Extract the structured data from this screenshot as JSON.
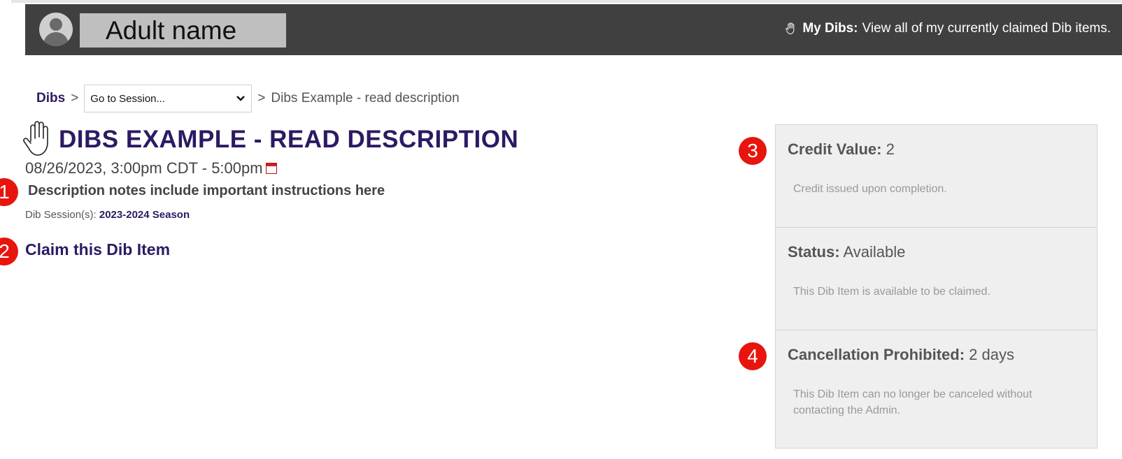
{
  "header": {
    "user_name": "Adult name",
    "my_dibs_label": "My Dibs:",
    "my_dibs_text": "View all of my currently claimed Dib items."
  },
  "breadcrumb": {
    "dibs": "Dibs",
    "separator": ">",
    "session_select": "Go to Session...",
    "current_prefix": ">",
    "current": "Dibs Example - read description"
  },
  "item": {
    "title": "DIBS EXAMPLE - READ DESCRIPTION",
    "datetime": "08/26/2023, 3:00pm CDT - 5:00pm",
    "description": "Description notes include important instructions here",
    "sessions_label": "Dib Session(s):",
    "sessions_value": "2023-2024 Season",
    "claim_label": "Claim this Dib Item"
  },
  "panel": {
    "credit": {
      "label": "Credit Value:",
      "value": "2",
      "note": "Credit issued upon completion."
    },
    "status": {
      "label": "Status:",
      "value": "Available",
      "note": "This Dib Item is available to be claimed."
    },
    "cancellation": {
      "label": "Cancellation Prohibited:",
      "value": "2 days",
      "note": "This Dib Item can no longer be canceled without contacting the Admin."
    }
  },
  "markers": [
    "1",
    "2",
    "3",
    "4"
  ],
  "colors": {
    "header_bg": "#404040",
    "accent": "#2d1a63",
    "marker": "#e8140e",
    "panel_bg": "#efefef"
  }
}
